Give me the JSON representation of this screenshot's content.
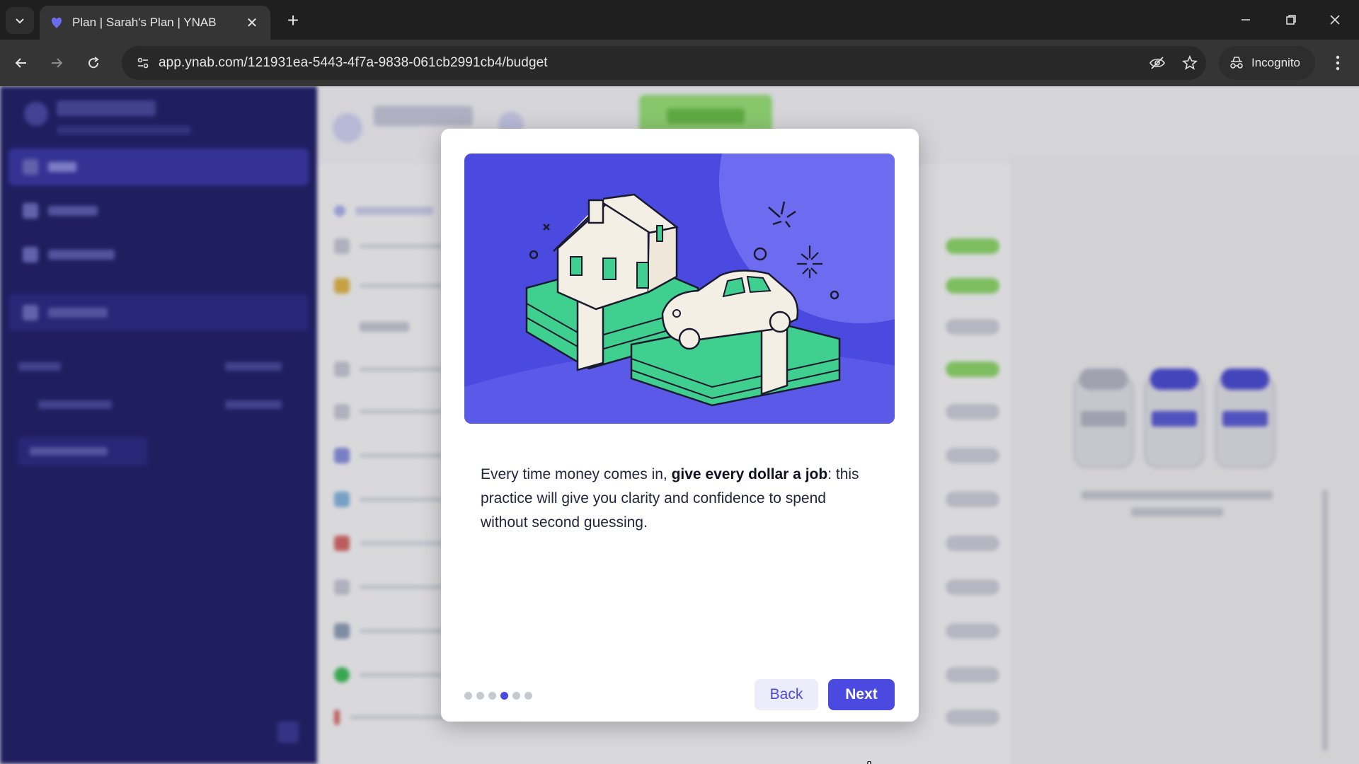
{
  "browser": {
    "tab_title": "Plan | Sarah's Plan | YNAB",
    "url": "app.ynab.com/121931ea-5443-4f7a-9838-061cb2991cb4/budget",
    "incognito_label": "Incognito"
  },
  "modal": {
    "text_before": "Every time money comes in, ",
    "text_bold": "give every dollar a job",
    "text_after": ": this practice will give you clarity and confidence to spend without second guessing.",
    "step_total": 6,
    "step_current": 4,
    "back_label": "Back",
    "next_label": "Next"
  },
  "colors": {
    "accent": "#4b4ae0",
    "sidebar": "#21206b",
    "money_green": "#3fcf8e"
  }
}
